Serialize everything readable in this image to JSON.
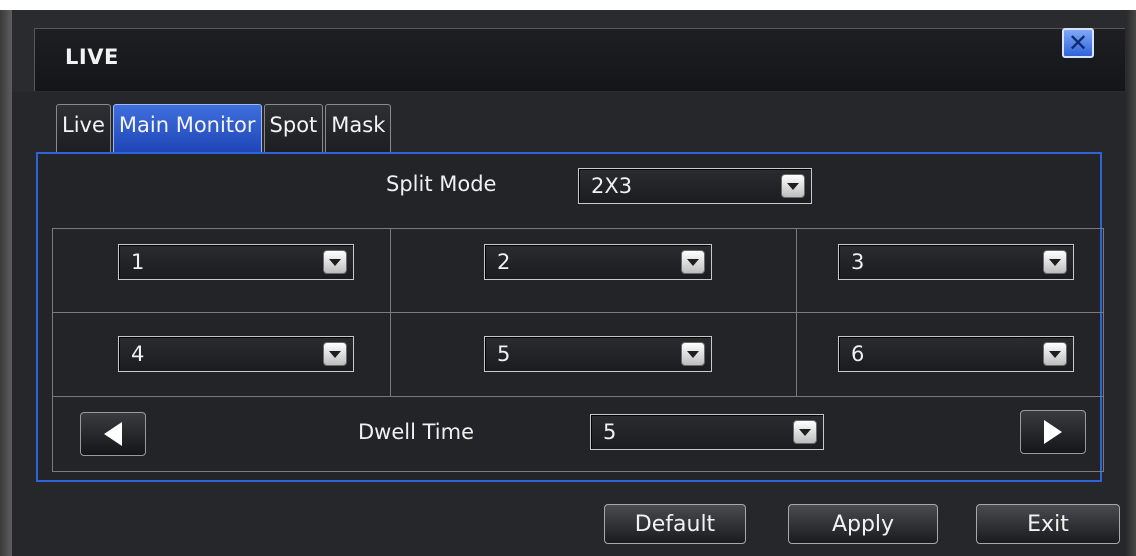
{
  "window": {
    "title": "LIVE",
    "close_icon": "close-icon"
  },
  "tabs": [
    {
      "label": "Live",
      "active": false
    },
    {
      "label": "Main Monitor",
      "active": true
    },
    {
      "label": "Spot",
      "active": false
    },
    {
      "label": "Mask",
      "active": false
    }
  ],
  "split_mode": {
    "label": "Split Mode",
    "value": "2X3"
  },
  "channels": [
    "1",
    "2",
    "3",
    "4",
    "5",
    "6"
  ],
  "dwell_time": {
    "label": "Dwell Time",
    "value": "5"
  },
  "buttons": {
    "default": "Default",
    "apply": "Apply",
    "exit": "Exit"
  },
  "colors": {
    "accent": "#2f63d8",
    "background": "#26272a"
  }
}
